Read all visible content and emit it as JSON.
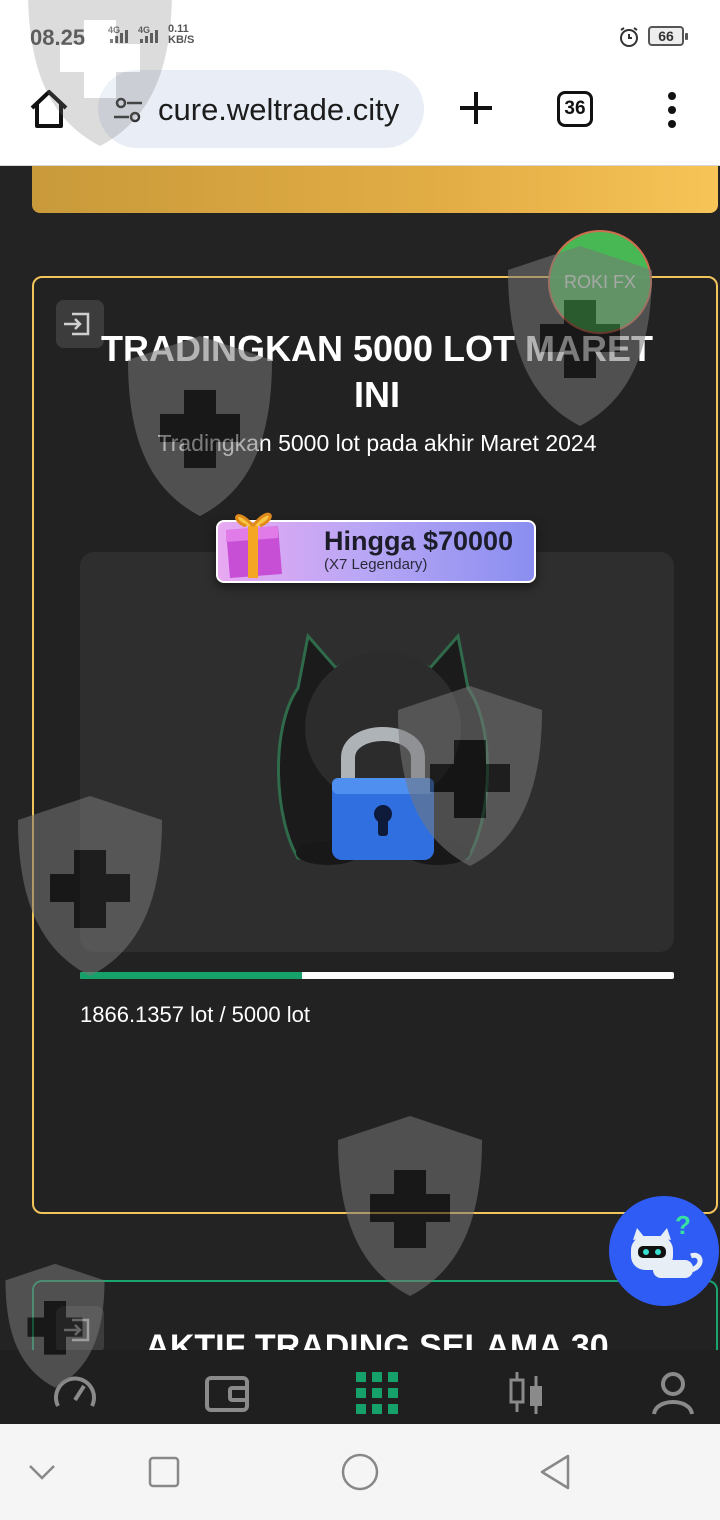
{
  "status_bar": {
    "time": "08.25",
    "signal1_label": "4G",
    "signal2_label": "4G",
    "net_speed_value": "0.11",
    "net_speed_unit": "KB/S",
    "battery": "66"
  },
  "browser": {
    "url": "cure.weltrade.city",
    "tab_count": "36"
  },
  "challenge_card": {
    "title": "TRADINGKAN 5000 LOT MARET INI",
    "subtitle": "Tradingkan 5000 lot pada akhir Maret 2024",
    "reward_value": "Hingga $70000",
    "reward_tier": "(X7 Legendary)",
    "progress_fraction": 0.3732,
    "progress_text": "1866.1357 lot / 5000 lot"
  },
  "watermark": "ROKI FX",
  "next_card": {
    "title": "AKTIF TRADING SELAMA 30"
  },
  "bottom_nav": {
    "items": [
      "speedometer-icon",
      "wallet-icon",
      "grid-icon",
      "candles-icon",
      "profile-icon"
    ],
    "active": "grid-icon"
  },
  "colors": {
    "accent_green": "#16a06a",
    "gold": "#f2c45c",
    "help_blue": "#2f5cf5"
  }
}
